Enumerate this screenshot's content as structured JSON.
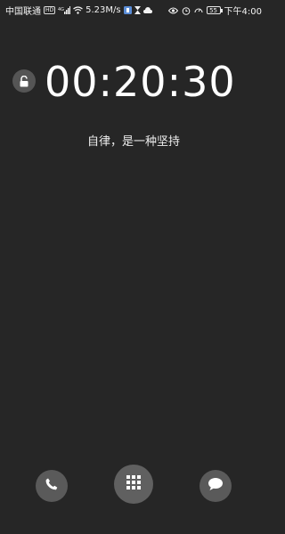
{
  "status_bar": {
    "carrier": "中国联通",
    "network_tag": "HD",
    "network_gen": "4G",
    "net_speed": "5.23M/s",
    "battery_level": "55",
    "time": "下午4:00",
    "icons": [
      "signal-icon",
      "wifi-icon",
      "app-notification-icon",
      "hourglass-icon",
      "cloud-icon",
      "eye-icon",
      "alarm-icon",
      "speedometer-icon",
      "battery-icon"
    ]
  },
  "lockscreen": {
    "clock": "00:20:30",
    "motto": "自律，是一种坚持"
  },
  "bottom_actions": {
    "icons": [
      "phone-icon",
      "app-grid-icon",
      "message-icon"
    ]
  },
  "colors": {
    "background": "#262626",
    "button": "#5a5a5a",
    "text": "#ffffff"
  }
}
